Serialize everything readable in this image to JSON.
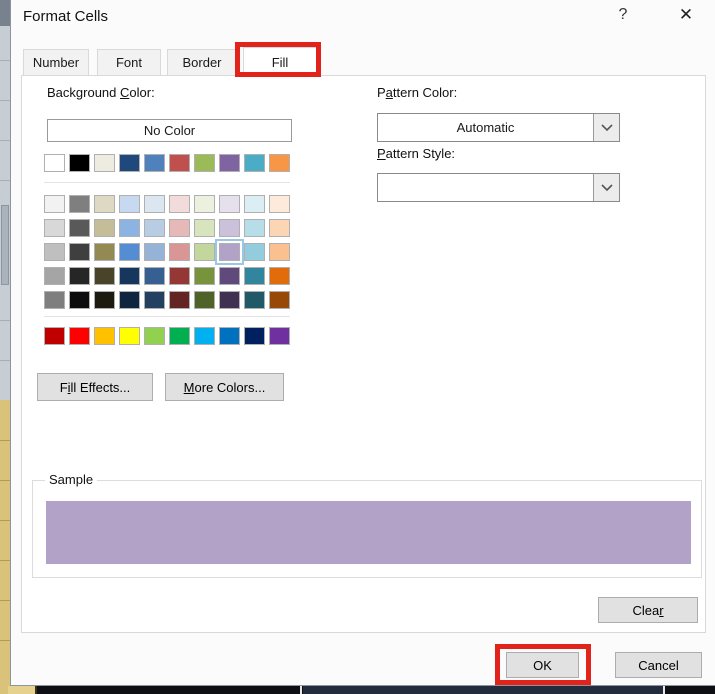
{
  "window": {
    "title": "Format Cells",
    "help_icon": "?",
    "close_icon": "✕"
  },
  "tabs": [
    {
      "label": "Number"
    },
    {
      "label": "Font"
    },
    {
      "label": "Border"
    },
    {
      "label": "Fill"
    }
  ],
  "active_tab": "Fill",
  "fill_tab": {
    "background_color_label": {
      "pre": "Background ",
      "accel": "C",
      "post": "olor:"
    },
    "no_color_label": "No Color",
    "theme_colors": [
      "#FFFFFF",
      "#000000",
      "#EEECE1",
      "#1F497D",
      "#4F81BD",
      "#C0504D",
      "#9BBB59",
      "#8064A2",
      "#4BACC6",
      "#F79646"
    ],
    "variant_rows": [
      [
        "#F2F2F2",
        "#7F7F7F",
        "#DDD9C3",
        "#C6D9F0",
        "#DCE6F1",
        "#F2DCDB",
        "#EBF1DE",
        "#E6E0EC",
        "#DBEEF4",
        "#FDEADA"
      ],
      [
        "#D8D8D8",
        "#595959",
        "#C4BD97",
        "#8DB3E2",
        "#B8CCE4",
        "#E6B9B8",
        "#D7E4BD",
        "#CCC1DA",
        "#B7DEE8",
        "#FCD5B5"
      ],
      [
        "#BFBFBF",
        "#3F3F3F",
        "#938953",
        "#548DD4",
        "#95B3D7",
        "#D99694",
        "#C3D69B",
        "#B3A2C7",
        "#93CDDD",
        "#FAC090"
      ],
      [
        "#A5A5A5",
        "#262626",
        "#494429",
        "#17365D",
        "#366092",
        "#953734",
        "#77933C",
        "#604A7B",
        "#31859C",
        "#E36C0A"
      ],
      [
        "#7F7F7F",
        "#0C0C0C",
        "#1D1B10",
        "#0F243E",
        "#244061",
        "#632423",
        "#4F6228",
        "#403152",
        "#215968",
        "#984807"
      ]
    ],
    "selected_swatch": {
      "grid": "variant",
      "row": 2,
      "col": 7,
      "color": "#B3A2C7"
    },
    "standard_colors": [
      "#C00000",
      "#FF0000",
      "#FFC000",
      "#FFFF00",
      "#92D050",
      "#00B050",
      "#00B0F0",
      "#0070C0",
      "#002060",
      "#7030A0"
    ],
    "fill_effects_label": {
      "pre": "F",
      "accel": "i",
      "post": "ll Effects..."
    },
    "more_colors_label": {
      "pre": "",
      "accel": "M",
      "post": "ore Colors..."
    },
    "pattern_color_label": {
      "pre": "P",
      "accel": "a",
      "post": "ttern Color:"
    },
    "pattern_color_value": "Automatic",
    "pattern_style_label": {
      "pre": "",
      "accel": "P",
      "post": "attern Style:"
    },
    "pattern_style_value": "",
    "sample_label": "Sample",
    "sample_fill_color": "#B3A2C7",
    "clear_label": {
      "pre": "Clea",
      "accel": "r",
      "post": ""
    }
  },
  "footer": {
    "ok_label": "OK",
    "cancel_label": "Cancel"
  },
  "annotation": {
    "color": "#E0241B",
    "highlighted": [
      "tab-fill",
      "ok-button"
    ]
  }
}
